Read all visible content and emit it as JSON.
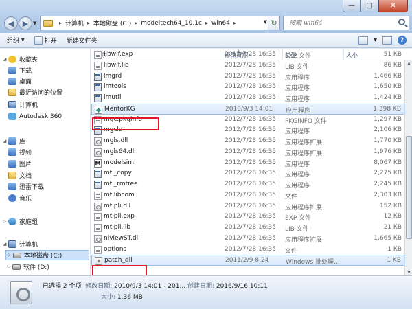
{
  "window": {
    "min_glyph": "—",
    "max_glyph": "□",
    "close_glyph": "✕"
  },
  "address": {
    "crumbs": [
      "计算机",
      "本地磁盘 (C:)",
      "modeltech64_10.1c",
      "win64"
    ],
    "sep": "▸",
    "root_sep": "▸"
  },
  "search": {
    "placeholder": "搜索 win64"
  },
  "toolbar": {
    "organize": "组织",
    "open": "打开",
    "new_folder": "新建文件夹"
  },
  "sidebar": {
    "items": [
      {
        "label": "收藏夹",
        "icon": "star-icon"
      },
      {
        "label": "下载",
        "icon": "folder-icon"
      },
      {
        "label": "桌面",
        "icon": "folder-icon"
      },
      {
        "label": "最近访问的位置",
        "icon": "folder-icon"
      },
      {
        "label": "计算机",
        "icon": "computer-icon"
      },
      {
        "label": "Autodesk 360",
        "icon": "cloud-icon"
      },
      {
        "label": "库",
        "icon": "library-icon"
      },
      {
        "label": "视频",
        "icon": "video-icon"
      },
      {
        "label": "图片",
        "icon": "picture-icon"
      },
      {
        "label": "文档",
        "icon": "document-icon"
      },
      {
        "label": "迅雷下载",
        "icon": "thunder-icon"
      },
      {
        "label": "音乐",
        "icon": "music-icon"
      },
      {
        "label": "家庭组",
        "icon": "homegroup-icon"
      },
      {
        "label": "计算机",
        "icon": "computer-icon"
      },
      {
        "label": "本地磁盘 (C:)",
        "icon": "drive-icon"
      },
      {
        "label": "软件 (D:)",
        "icon": "drive-icon"
      }
    ]
  },
  "columns": {
    "name": "名称",
    "date": "修改日期",
    "type": "类型",
    "size": "大小"
  },
  "files": [
    {
      "name": "libwlf.exp",
      "date": "2012/7/28 16:35",
      "type": "EXP 文件",
      "size": "51 KB",
      "icon": "lib"
    },
    {
      "name": "libwlf.lib",
      "date": "2012/7/28 16:35",
      "type": "LIB 文件",
      "size": "86 KB",
      "icon": "lib"
    },
    {
      "name": "lmgrd",
      "date": "2012/7/28 16:35",
      "type": "应用程序",
      "size": "1,466 KB",
      "icon": "exe"
    },
    {
      "name": "lmtools",
      "date": "2012/7/28 16:35",
      "type": "应用程序",
      "size": "1,650 KB",
      "icon": "exe"
    },
    {
      "name": "lmutil",
      "date": "2012/7/28 16:35",
      "type": "应用程序",
      "size": "1,424 KB",
      "icon": "exe"
    },
    {
      "name": "MentorKG",
      "date": "2010/9/3 14:01",
      "type": "应用程序",
      "size": "1,398 KB",
      "icon": "mentor"
    },
    {
      "name": "mgc.pkgInfo",
      "date": "2012/7/28 16:35",
      "type": "PKGINFO 文件",
      "size": "1,297 KB",
      "icon": "lib"
    },
    {
      "name": "mgcld",
      "date": "2012/7/28 16:35",
      "type": "应用程序",
      "size": "2,106 KB",
      "icon": "exe"
    },
    {
      "name": "mgls.dll",
      "date": "2012/7/28 16:35",
      "type": "应用程序扩展",
      "size": "1,770 KB",
      "icon": "dll"
    },
    {
      "name": "mgls64.dll",
      "date": "2012/7/28 16:35",
      "type": "应用程序扩展",
      "size": "1,976 KB",
      "icon": "dll"
    },
    {
      "name": "modelsim",
      "date": "2012/7/28 16:35",
      "type": "应用程序",
      "size": "8,067 KB",
      "icon": "m"
    },
    {
      "name": "mti_copy",
      "date": "2012/7/28 16:35",
      "type": "应用程序",
      "size": "2,275 KB",
      "icon": "exe"
    },
    {
      "name": "mti_rmtree",
      "date": "2012/7/28 16:35",
      "type": "应用程序",
      "size": "2,245 KB",
      "icon": "exe"
    },
    {
      "name": "mtilibcom",
      "date": "2012/7/28 16:35",
      "type": "文件",
      "size": "2,303 KB",
      "icon": "lib"
    },
    {
      "name": "mtipli.dll",
      "date": "2012/7/28 16:35",
      "type": "应用程序扩展",
      "size": "152 KB",
      "icon": "dll"
    },
    {
      "name": "mtipli.exp",
      "date": "2012/7/28 16:35",
      "type": "EXP 文件",
      "size": "12 KB",
      "icon": "lib"
    },
    {
      "name": "mtipli.lib",
      "date": "2012/7/28 16:35",
      "type": "LIB 文件",
      "size": "21 KB",
      "icon": "lib"
    },
    {
      "name": "nlviewST.dll",
      "date": "2012/7/28 16:35",
      "type": "应用程序扩展",
      "size": "1,665 KB",
      "icon": "dll"
    },
    {
      "name": "options",
      "date": "2012/7/28 16:35",
      "type": "文件",
      "size": "1 KB",
      "icon": "lib"
    },
    {
      "name": "patch_dll",
      "date": "2011/2/9 8:24",
      "type": "Windows 批处理...",
      "size": "1 KB",
      "icon": "bat"
    }
  ],
  "status": {
    "selected": "已选择 2 个项",
    "modified_label": "修改日期:",
    "modified_value": "2010/9/3 14:01 - 201...",
    "created_label": "创建日期:",
    "created_value": "2016/9/16 10:11",
    "size_label": "大小:",
    "size_value": "1.36 MB"
  }
}
